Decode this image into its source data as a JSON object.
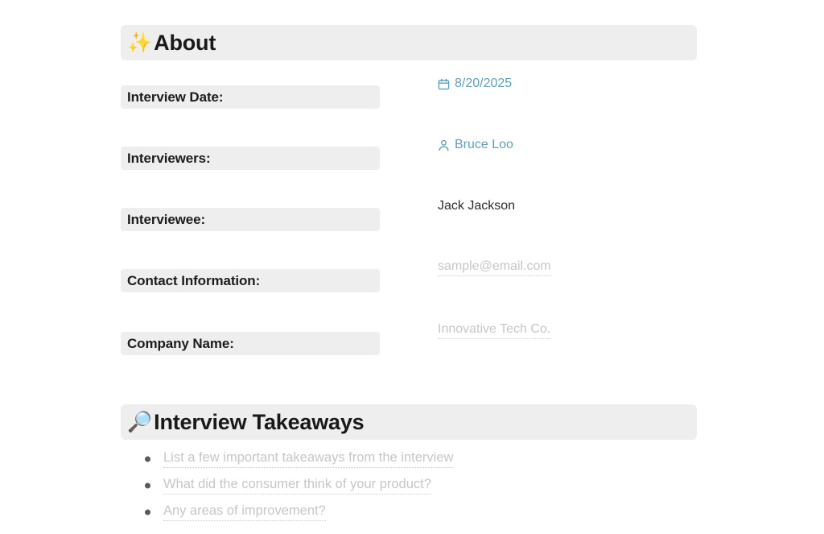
{
  "document": {
    "sections": [
      {
        "id": "about",
        "icon": "sparkles-icon",
        "emoji": "✨",
        "title": "About"
      },
      {
        "id": "interview-takeaways",
        "icon": "magnifying-glass-icon",
        "emoji": "🔎",
        "title": "Interview Takeaways"
      }
    ],
    "fields": [
      {
        "label": "Interview Date:",
        "value": "8/20/2025",
        "icon": "calendar-icon",
        "style": "link"
      },
      {
        "label": "Interviewers:",
        "value": "Bruce Loo",
        "icon": "person-icon",
        "style": "link"
      },
      {
        "label": "Interviewee:",
        "value": "Jack Jackson",
        "icon": "",
        "style": "plain"
      },
      {
        "label": "Contact Information:",
        "value": "sample@email.com",
        "icon": "",
        "style": "placeholder"
      },
      {
        "label": "Company Name:",
        "value": "Innovative Tech Co.",
        "icon": "",
        "style": "placeholder"
      }
    ],
    "takeaways": [
      {
        "text": "List a few important takeaways from the interview"
      },
      {
        "text": "What did the consumer think of your product?"
      },
      {
        "text": "Any areas of improvement?"
      }
    ],
    "colors": {
      "section_bar": "#eeeeee",
      "label_pill": "#eeeeee",
      "link_value": "#5f9fba",
      "placeholder_text": "#c6c6c6",
      "heading_text": "#191919",
      "bullet": "#5a5a5a",
      "sparkle_emoji": "#f5cf5a"
    }
  }
}
